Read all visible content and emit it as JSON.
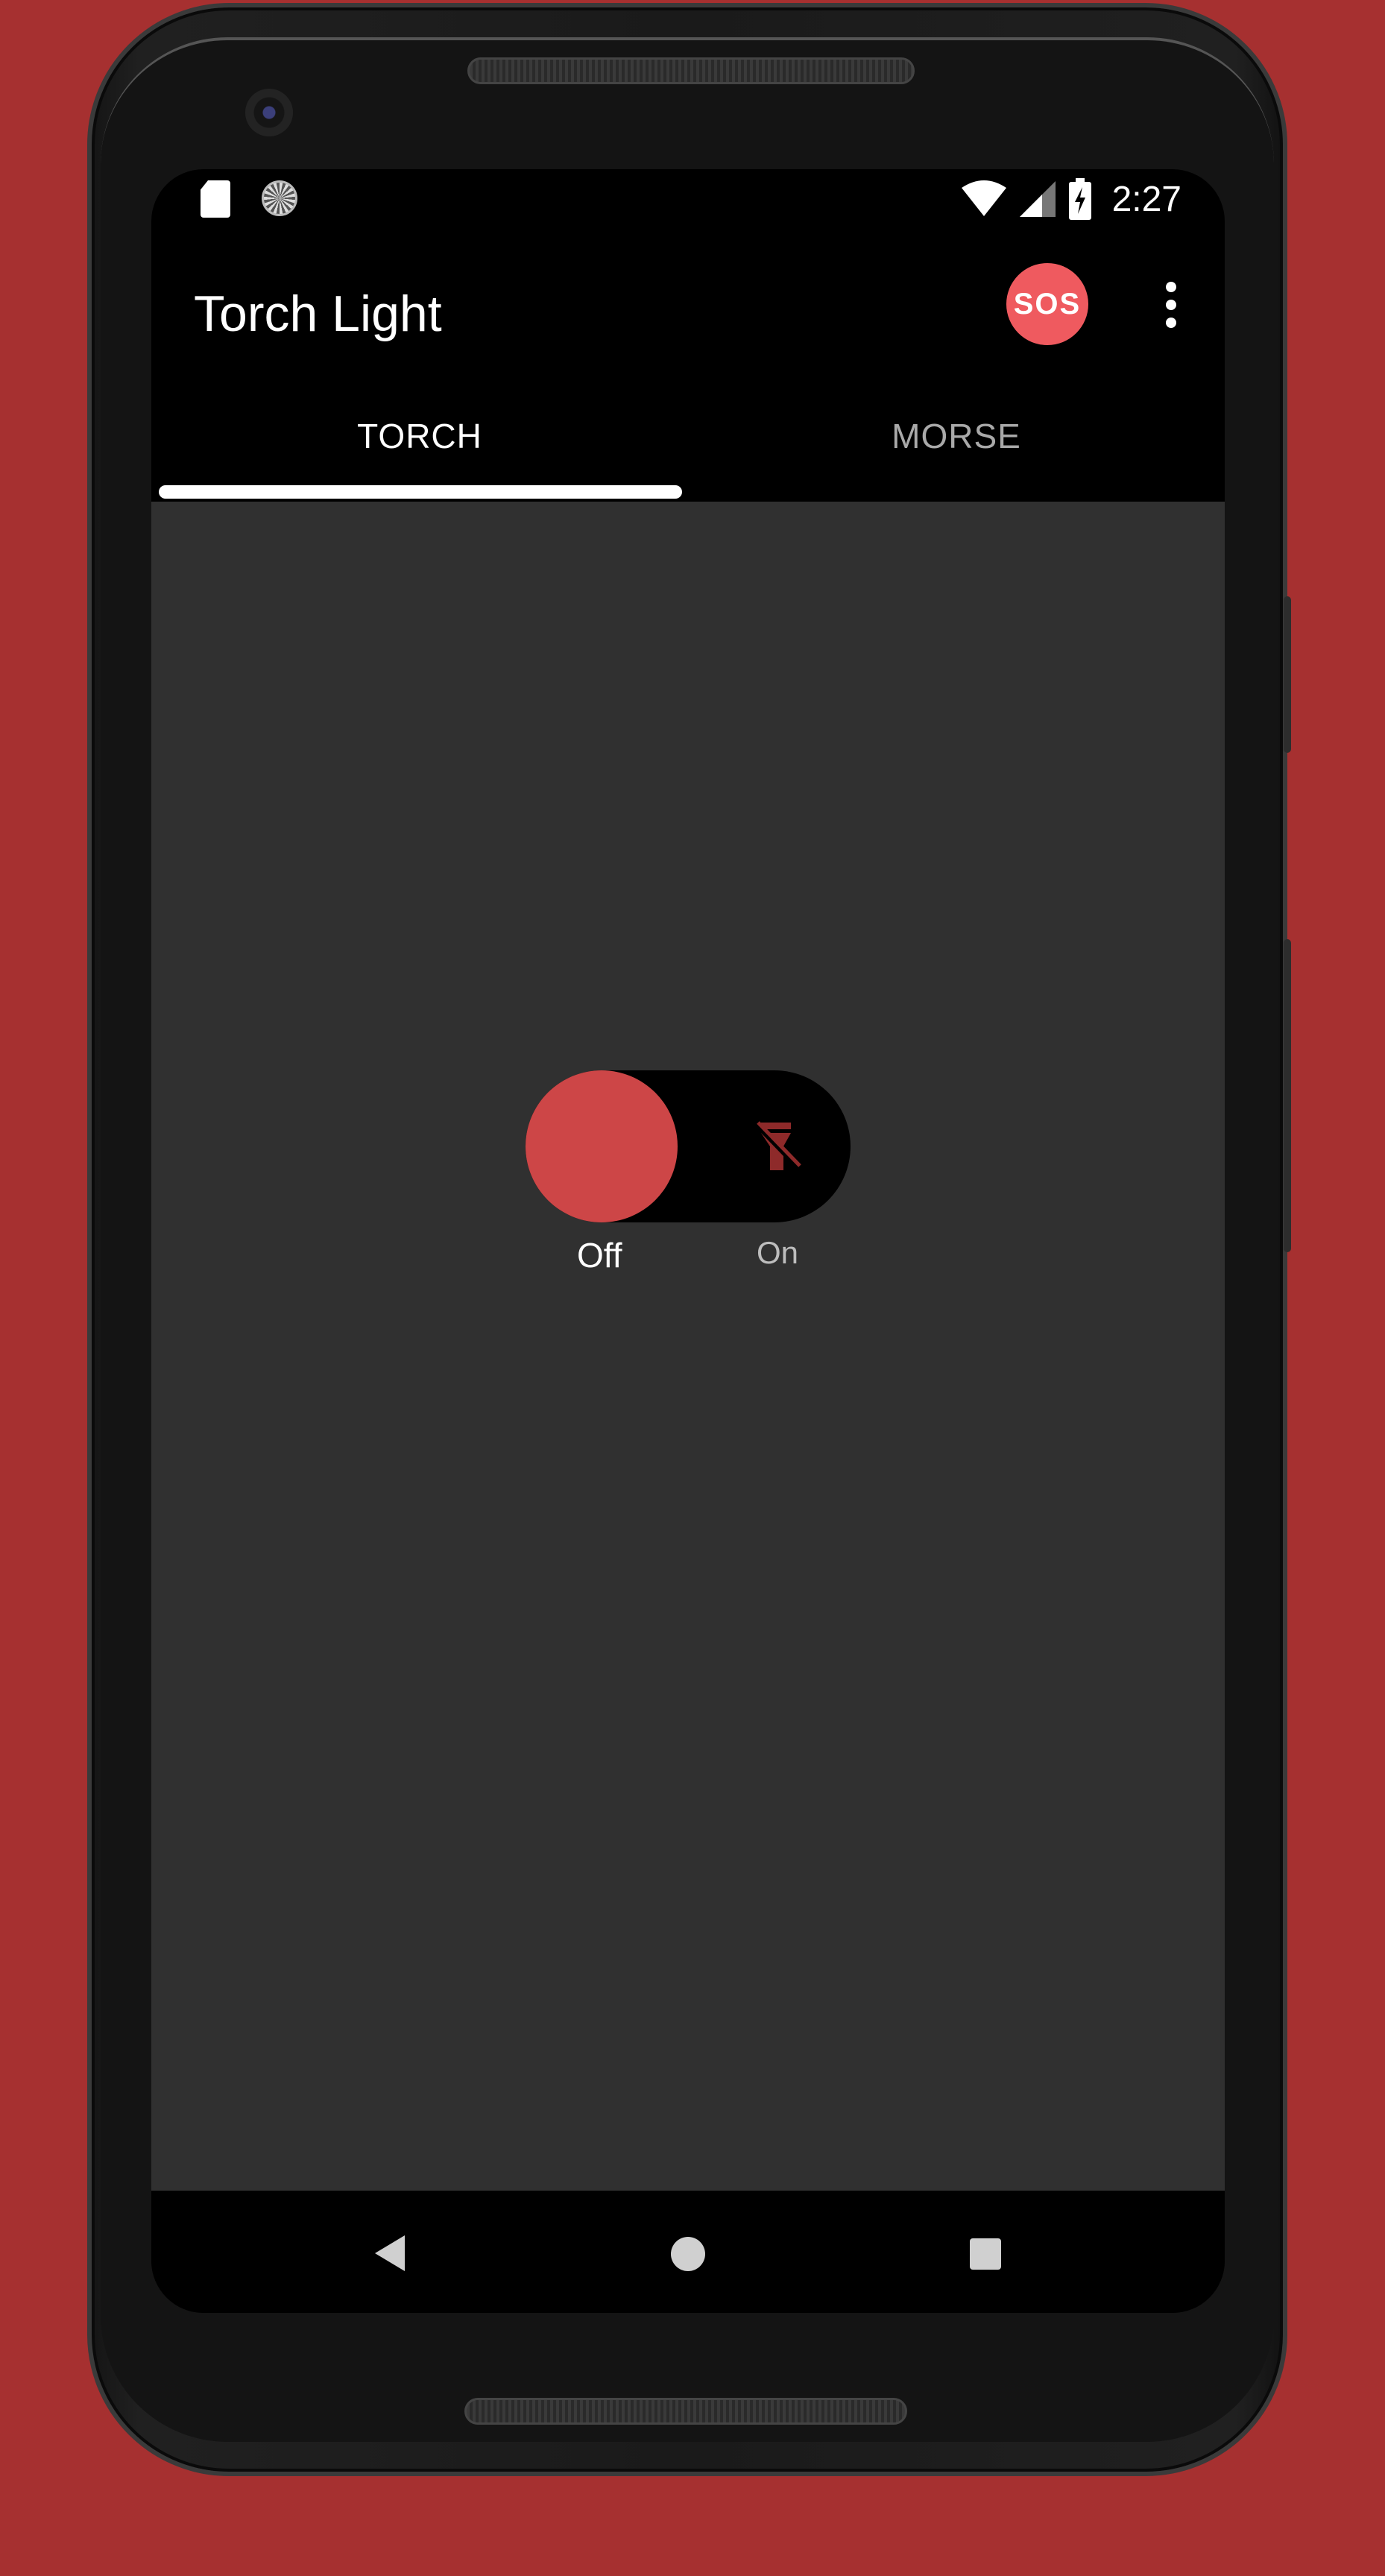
{
  "status_bar": {
    "time": "2:27",
    "icons": [
      "sd-card-icon",
      "sync-icon",
      "wifi-icon",
      "cell-signal-icon",
      "battery-charging-icon"
    ]
  },
  "app_bar": {
    "title": "Torch Light",
    "sos_label": "SOS",
    "overflow_icon": "more-vert-icon"
  },
  "tabs": [
    {
      "label": "TORCH",
      "selected": true
    },
    {
      "label": "MORSE",
      "selected": false
    }
  ],
  "torch_switch": {
    "state": "off",
    "off_label": "Off",
    "on_label": "On",
    "icon": "flash-off-icon"
  },
  "colors": {
    "background": "#a63030",
    "accent": "#cd4647",
    "sos": "#ef5a5f",
    "content_bg": "#303030"
  },
  "nav_bar": {
    "icons": [
      "back-icon",
      "home-icon",
      "recents-icon"
    ]
  }
}
